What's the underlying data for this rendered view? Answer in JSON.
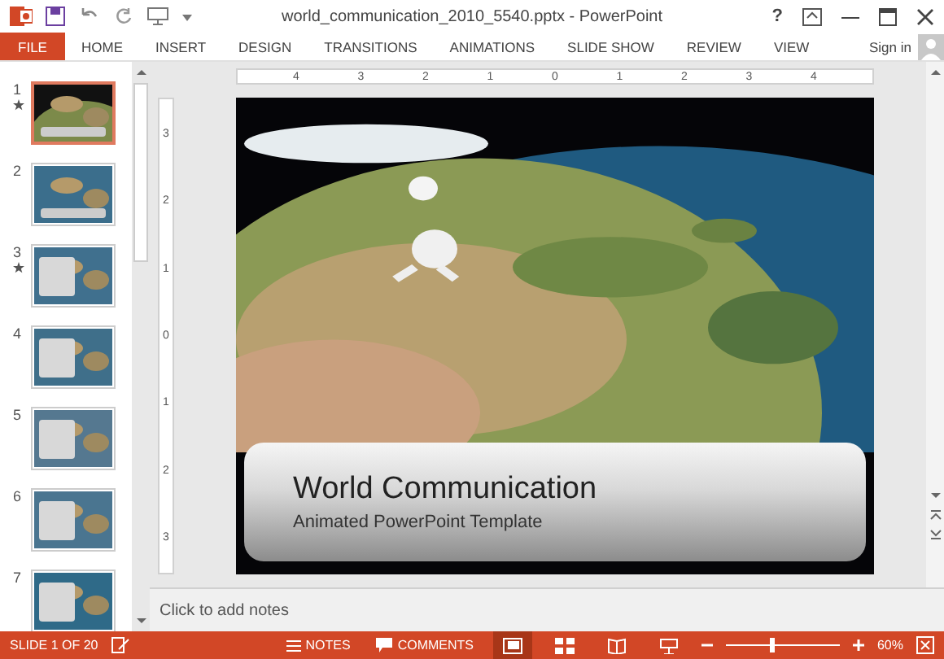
{
  "window": {
    "title": "world_communication_2010_5540.pptx - PowerPoint",
    "help": "?",
    "sign_in": "Sign in"
  },
  "ribbon_tabs": [
    {
      "label": "FILE",
      "kind": "file",
      "selected": false
    },
    {
      "label": "HOME",
      "kind": "tab",
      "selected": false
    },
    {
      "label": "INSERT",
      "kind": "tab",
      "selected": false
    },
    {
      "label": "DESIGN",
      "kind": "tab",
      "selected": false
    },
    {
      "label": "TRANSITIONS",
      "kind": "tab",
      "selected": false
    },
    {
      "label": "ANIMATIONS",
      "kind": "tab",
      "selected": false
    },
    {
      "label": "SLIDE SHOW",
      "kind": "tab",
      "selected": false
    },
    {
      "label": "REVIEW",
      "kind": "tab",
      "selected": false
    },
    {
      "label": "VIEW",
      "kind": "tab",
      "selected": false
    }
  ],
  "thumbnails": [
    {
      "number": "1",
      "selected": true,
      "animated": true
    },
    {
      "number": "2",
      "selected": false,
      "animated": false
    },
    {
      "number": "3",
      "selected": false,
      "animated": true
    },
    {
      "number": "4",
      "selected": false,
      "animated": false
    },
    {
      "number": "5",
      "selected": false,
      "animated": false
    },
    {
      "number": "6",
      "selected": false,
      "animated": false
    },
    {
      "number": "7",
      "selected": false,
      "animated": false
    }
  ],
  "horizontal_ruler": [
    "4",
    "3",
    "2",
    "1",
    "0",
    "1",
    "2",
    "3",
    "4"
  ],
  "vertical_ruler": [
    "3",
    "2",
    "1",
    "0",
    "1",
    "2",
    "3"
  ],
  "slide": {
    "title": "World Communication",
    "subtitle": "Animated PowerPoint Template"
  },
  "notes": {
    "placeholder": "Click to add notes"
  },
  "status_bar": {
    "slide_count": "SLIDE 1 OF 20",
    "notes": "NOTES",
    "comments": "COMMENTS",
    "views": [
      {
        "kind": "normal",
        "selected": true
      },
      {
        "kind": "sorter",
        "selected": false
      },
      {
        "kind": "reading",
        "selected": false
      },
      {
        "kind": "show",
        "selected": false
      }
    ],
    "zoom": {
      "level": 0.4,
      "reading": "60%"
    }
  }
}
